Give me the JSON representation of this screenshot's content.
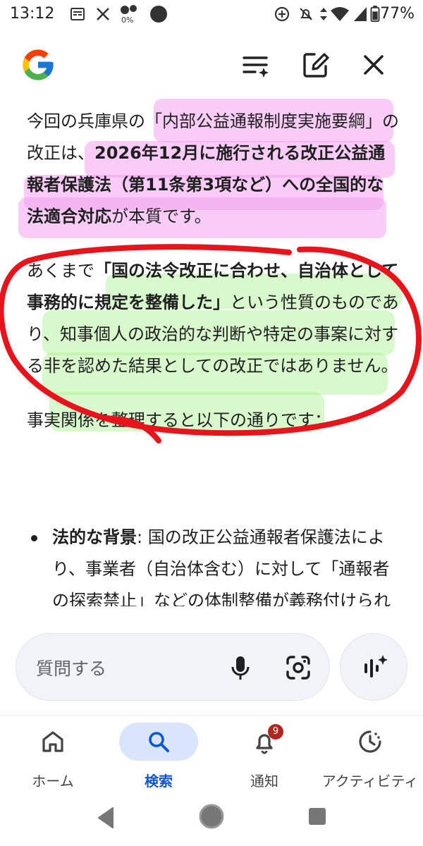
{
  "status_bar": {
    "time": "13:12",
    "data_saver_text": "0%",
    "battery_text": "77%",
    "icons_left": [
      "news-icon",
      "x-icon",
      "data-saver-icon",
      "circle-icon"
    ],
    "icons_right": [
      "vpn-icon",
      "silent-icon",
      "data-transfer-icon",
      "wifi-icon",
      "no-sim-icon",
      "battery-icon"
    ]
  },
  "header": {
    "logo": "google-logo",
    "actions": [
      "customize-icon",
      "edit-icon",
      "close-icon"
    ]
  },
  "answer": {
    "p1": {
      "t1": "今回の兵庫県の「内部公益通報制度実施要綱」の改正は、",
      "b1": "2026年12月に施行される改正公益通報者保護法（第11条第3項など）への全国的な法適合対応",
      "t2": "が本質です。"
    },
    "p2": {
      "t1": "あくまで",
      "b1": "「国の法令改正に合わせ、自治体として事務的に規定を整備した」",
      "t2": "という性質のものであり、知事個人の政治的な判断や特定の事案に対する非を認めた結果としての改正ではありません。"
    },
    "p3": "事実関係を整理すると以下の通りです：",
    "bullet1": {
      "label": "法的な背景",
      "text": ": 国の改正公益通報者保護法により、事業者（自治体含む）に対して「通報者の探索禁止」などの体制整備が義務付けられました。"
    }
  },
  "annotations": {
    "pink_highlight_color": "#f3a3f0",
    "green_highlight_color": "#a8f28c",
    "red_circle_color": "#e8141b"
  },
  "input": {
    "placeholder": "質問する",
    "mic_icon": "mic-icon",
    "lens_icon": "lens-icon",
    "voice_icon": "live-voice-icon"
  },
  "bottom_nav": {
    "active_color": "#0b57d0",
    "items": [
      {
        "label": "ホーム",
        "icon": "home-icon"
      },
      {
        "label": "検索",
        "icon": "search-icon"
      },
      {
        "label": "通知",
        "icon": "bell-icon",
        "badge": "9"
      },
      {
        "label": "アクティビティ",
        "icon": "activity-icon"
      }
    ]
  },
  "system_nav": [
    "back-icon",
    "home-circle-icon",
    "recents-icon"
  ]
}
